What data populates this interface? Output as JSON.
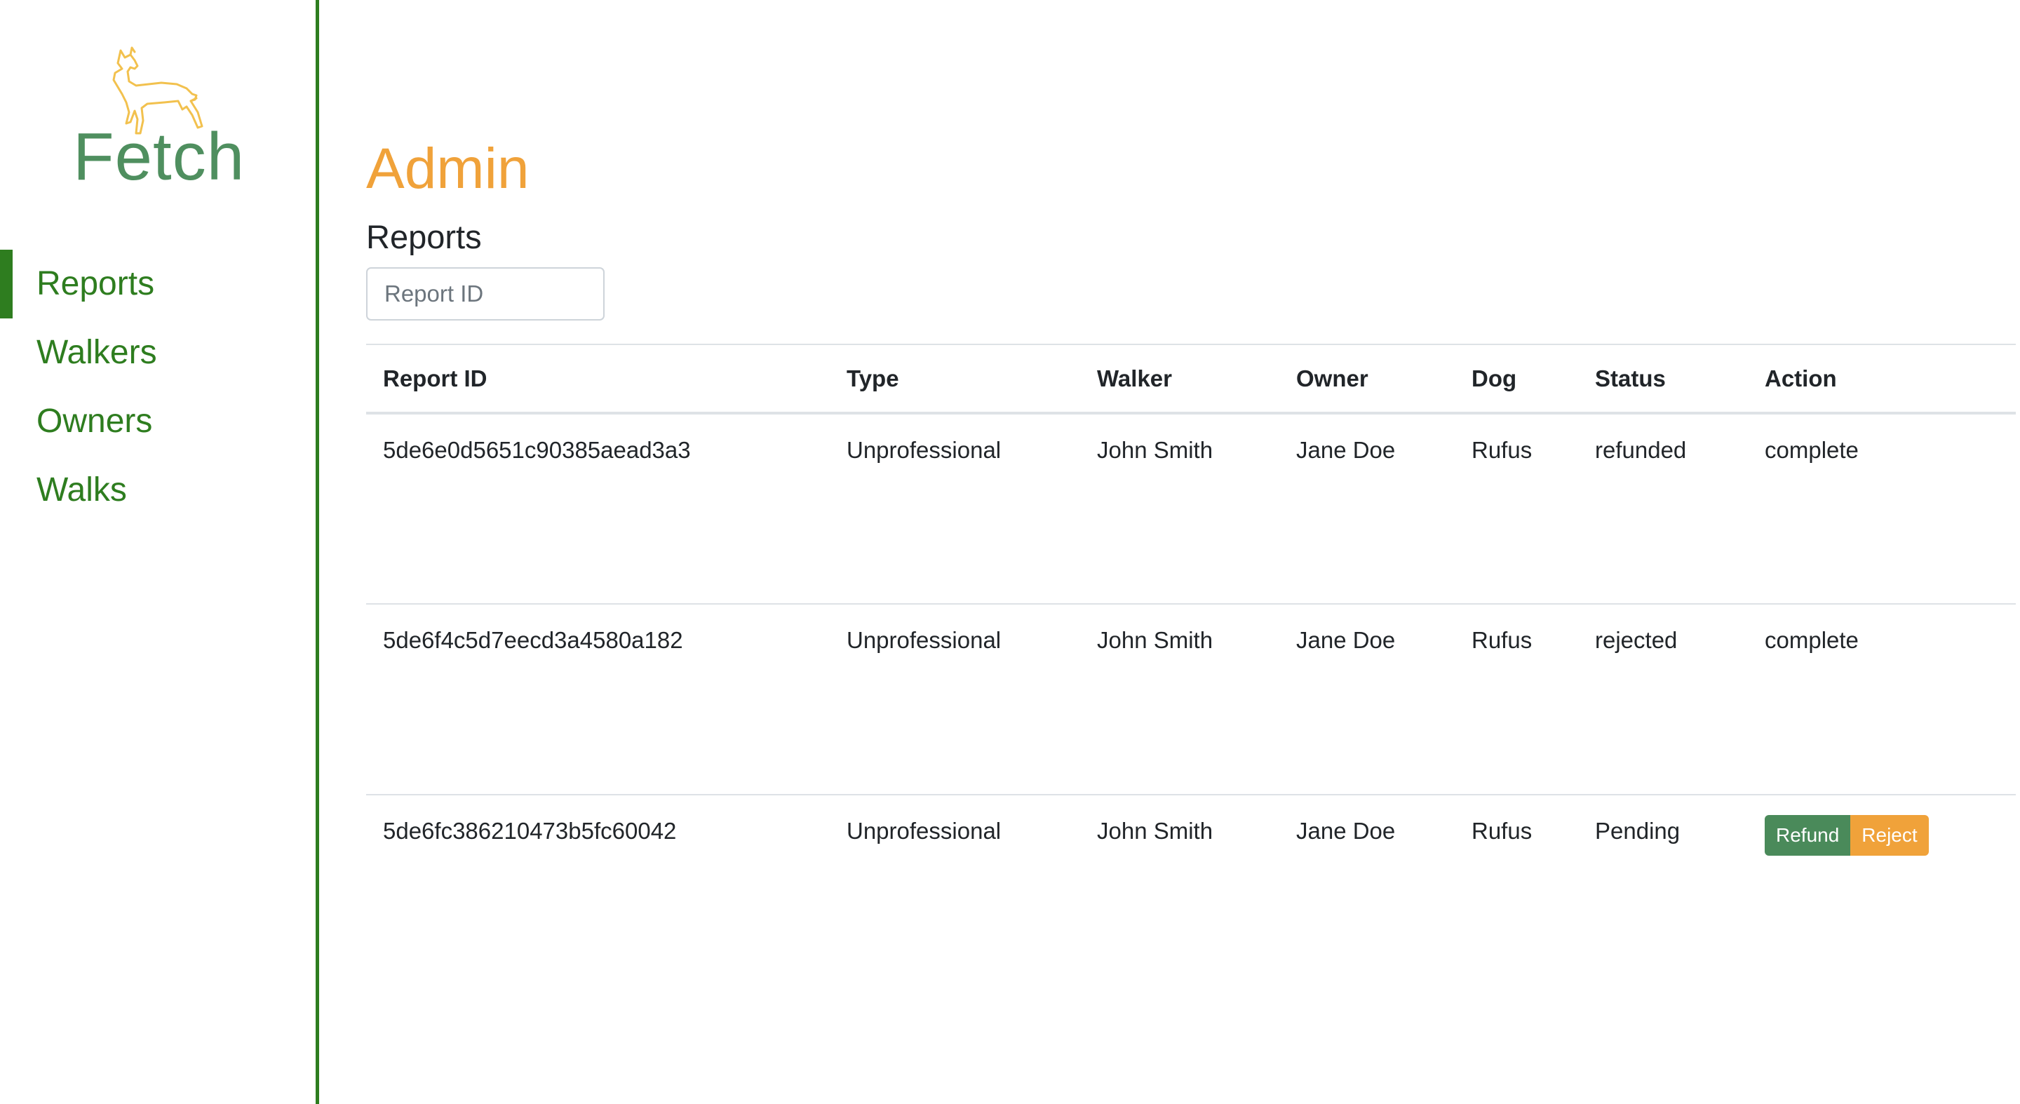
{
  "app": {
    "logo_text": "Fetch"
  },
  "sidebar": {
    "items": [
      {
        "label": "Reports",
        "active": true
      },
      {
        "label": "Walkers",
        "active": false
      },
      {
        "label": "Owners",
        "active": false
      },
      {
        "label": "Walks",
        "active": false
      }
    ]
  },
  "main": {
    "title": "Admin",
    "section_title": "Reports",
    "search": {
      "placeholder": "Report ID",
      "value": ""
    }
  },
  "table": {
    "columns": [
      "Report ID",
      "Type",
      "Walker",
      "Owner",
      "Dog",
      "Status",
      "Action"
    ],
    "rows": [
      {
        "report_id": "5de6e0d5651c90385aead3a3",
        "type": "Unprofessional",
        "walker": "John Smith",
        "owner": "Jane Doe",
        "dog": "Rufus",
        "status": "refunded",
        "action": "complete"
      },
      {
        "report_id": "5de6f4c5d7eecd3a4580a182",
        "type": "Unprofessional",
        "walker": "John Smith",
        "owner": "Jane Doe",
        "dog": "Rufus",
        "status": "rejected",
        "action": "complete"
      },
      {
        "report_id": "5de6fc386210473b5fc60042",
        "type": "Unprofessional",
        "walker": "John Smith",
        "owner": "Jane Doe",
        "dog": "Rufus",
        "status": "Pending",
        "action": "",
        "buttons": {
          "refund": "Refund",
          "reject": "Reject"
        }
      }
    ]
  },
  "colors": {
    "brand_green": "#2e7d1f",
    "title_orange": "#f0a23a",
    "refund_green": "#4a8a5a",
    "reject_orange": "#f0a23a",
    "logo_dog": "#f2c14e"
  },
  "icons": {
    "logo": "dog-icon"
  }
}
